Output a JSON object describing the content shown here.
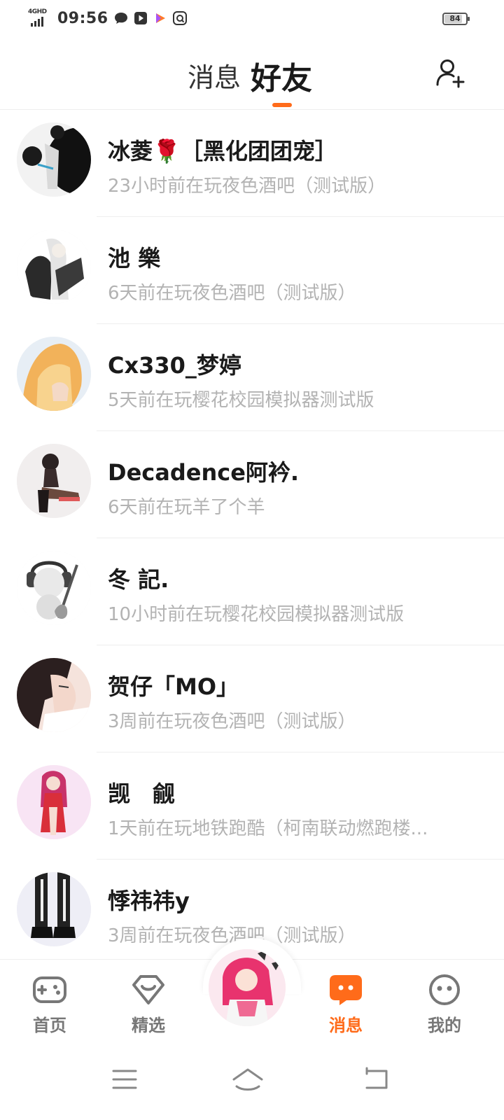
{
  "status_bar": {
    "network": "4GHD",
    "time": "09:56",
    "battery": "84",
    "battery_level": 0.84,
    "icons": [
      "chat-bubble-icon",
      "play-box-icon",
      "video-app-icon",
      "browser-app-icon"
    ]
  },
  "header": {
    "tabs": [
      {
        "label": "消息",
        "active": false
      },
      {
        "label": "好友",
        "active": true
      }
    ],
    "add_friend_icon": "add-user-icon",
    "accent_color": "#ff6b1a"
  },
  "friends": [
    {
      "name": "冰菱🌹［黑化团团宠］",
      "status": "23小时前在玩夜色酒吧（测试版）"
    },
    {
      "name": "池 樂",
      "status": "6天前在玩夜色酒吧（测试版）"
    },
    {
      "name": "Cx330_梦婷",
      "status": "5天前在玩樱花校园模拟器测试版"
    },
    {
      "name": "Decadence阿衿.",
      "status": "6天前在玩羊了个羊"
    },
    {
      "name": "冬 記.",
      "status": "10小时前在玩樱花校园模拟器测试版"
    },
    {
      "name": "贺仔「MO」",
      "status": "3周前在玩夜色酒吧（测试版）"
    },
    {
      "name": "觊　觎",
      "status": "1天前在玩地铁跑酷（柯南联动燃跑楼..."
    },
    {
      "name": "悸祎祎y",
      "status": "3周前在玩夜色酒吧（测试版）"
    }
  ],
  "bottom_nav": {
    "items": [
      {
        "label": "首页",
        "icon": "gamepad-icon",
        "active": false
      },
      {
        "label": "精选",
        "icon": "heart-badge-icon",
        "active": false
      },
      {
        "label": "消息",
        "icon": "message-icon",
        "active": true
      },
      {
        "label": "我的",
        "icon": "smiley-icon",
        "active": false
      }
    ]
  },
  "system_nav": [
    "menu-icon",
    "home-icon",
    "back-icon"
  ]
}
